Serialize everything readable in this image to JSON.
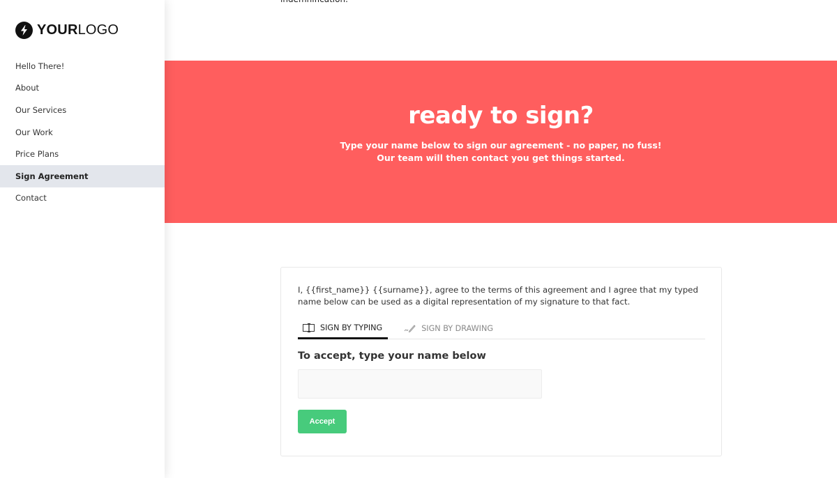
{
  "logo": {
    "icon": "lightning-bolt-icon",
    "text_bold": "YOUR",
    "text_light": "LOGO"
  },
  "sidebar": {
    "items": [
      {
        "label": "Hello There!",
        "active": false
      },
      {
        "label": "About",
        "active": false
      },
      {
        "label": "Our Services",
        "active": false
      },
      {
        "label": "Our Work",
        "active": false
      },
      {
        "label": "Price Plans",
        "active": false
      },
      {
        "label": "Sign Agreement",
        "active": true
      },
      {
        "label": "Contact",
        "active": false
      }
    ]
  },
  "main": {
    "top_fragment": "indemnification.",
    "hero": {
      "title": "ready to sign?",
      "subtitle_line1": "Type your name below to sign our agreement - no paper, no fuss!",
      "subtitle_line2": "Our team will then contact you get things started.",
      "background_color": "#ff5e5e"
    },
    "sign_card": {
      "agreement_text": "I, {{first_name}} {{surname}}, agree to the terms of this agreement and I agree that my typed name below can be used as a digital representation of my signature to that fact.",
      "tabs": [
        {
          "label": "SIGN BY TYPING",
          "icon": "keyboard-cursor-icon",
          "active": true
        },
        {
          "label": "SIGN BY DRAWING",
          "icon": "pen-signature-icon",
          "active": false
        }
      ],
      "accept_heading": "To accept, type your name below",
      "name_input": {
        "value": "",
        "placeholder": ""
      },
      "accept_button_label": "Accept",
      "accept_button_color": "#47cb7c"
    }
  }
}
